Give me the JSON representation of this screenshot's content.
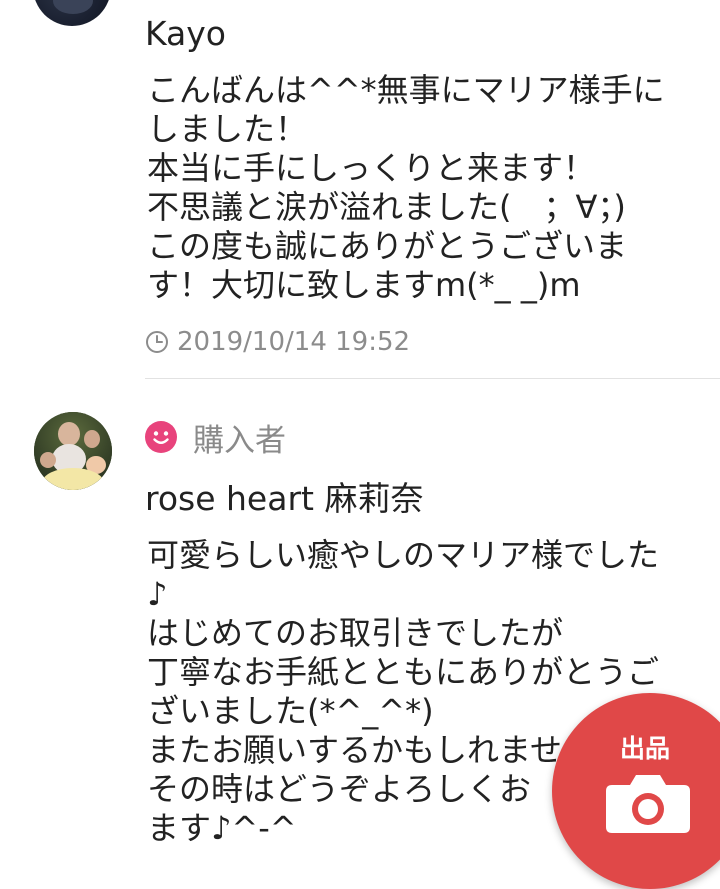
{
  "comment1": {
    "username": "Kayo",
    "lines": [
      "こんばんは^^*無事にマリア様手に",
      "しました！",
      "本当に手にしっくりと来ます！",
      "不思議と涙が溢れました(　；∀；)",
      "この度も誠にありがとうございま",
      "す！大切に致しますm(*_ _)m"
    ],
    "timestamp": "2019/10/14 19:52",
    "clock_icon": "clock-icon"
  },
  "comment2": {
    "badge_label": "購入者",
    "badge_icon": "smiley-icon",
    "username": "rose heart  麻莉奈",
    "lines": [
      "可愛らしい癒やしのマリア様でした",
      "♪",
      "はじめてのお取引きでしたが",
      "丁寧なお手紙とともにありがとうご",
      "ざいました(*^_^*)",
      "またお願いするかもしれませ",
      "その時はどうぞよろしくお",
      "ます♪^-^"
    ]
  },
  "fab": {
    "label": "出品",
    "icon": "camera-icon"
  },
  "colors": {
    "accent": "#e04848",
    "badge_pink": "#e8437c",
    "text": "#222222",
    "muted": "#8c8c8c"
  }
}
